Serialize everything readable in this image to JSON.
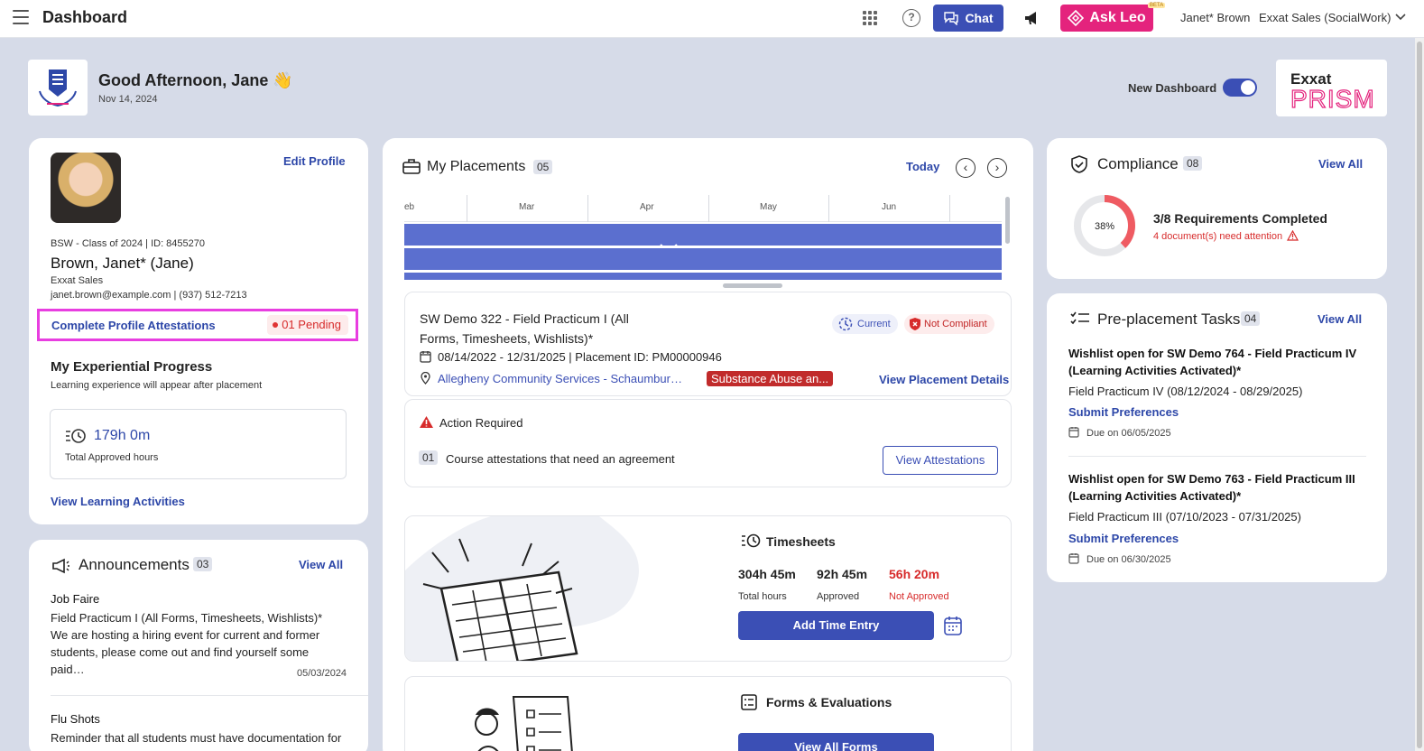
{
  "header": {
    "title": "Dashboard",
    "chat_label": "Chat",
    "askleo_label": "Ask Leo",
    "beta_label": "BETA",
    "user_name": "Janet* Brown",
    "user_org": "Exxat Sales (SocialWork)"
  },
  "greeting": {
    "title": "Good Afternoon, Jane 👋",
    "date": "Nov 14, 2024",
    "new_dashboard_label": "New Dashboard",
    "prism_line1": "Exxat",
    "prism_line2": "PRISM"
  },
  "profile": {
    "edit_label": "Edit Profile",
    "class_line": "BSW - Class of 2024  | ID: 8455270",
    "name": "Brown, Janet* (Jane)",
    "org": "Exxat Sales",
    "contact": "janet.brown@example.com  | (937) 512-7213",
    "attestations_link": "Complete Profile Attestations",
    "pending_label": "01 Pending",
    "progress_title": "My Experiential Progress",
    "progress_sub": "Learning experience will appear after placement",
    "hours_value": "179h 0m",
    "hours_label": "Total Approved hours",
    "view_learning": "View Learning Activities"
  },
  "announcements": {
    "title": "Announcements",
    "count": "03",
    "view_all": "View All",
    "items": [
      {
        "title": "Job Faire",
        "course": "Field Practicum I (All Forms, Timesheets, Wishlists)*",
        "body": "We are hosting a hiring event for current and former students, please come out and find yourself some paid…",
        "date": "05/03/2024"
      },
      {
        "title": "Flu Shots",
        "body": "Reminder that all students must have documentation for"
      }
    ]
  },
  "placements": {
    "title": "My Placements",
    "count": "05",
    "today_label": "Today",
    "timeline_months": [
      "eb",
      "Mar",
      "Apr",
      "May",
      "Jun"
    ],
    "course": "SW Demo 322 - Field Practicum I (All Forms, Timesheets, Wishlists)*",
    "status_current": "Current",
    "status_compliance": "Not Compliant",
    "dates": "08/14/2022 - 12/31/2025 | Placement ID: PM00000946",
    "site": "Allegheny Community Services - Schaumburg…",
    "tag": "Substance Abuse an...",
    "view_details": "View Placement Details",
    "action_title": "Action Required",
    "action_num": "01",
    "action_text": "Course attestations that need an agreement",
    "action_button": "View Attestations"
  },
  "timesheets": {
    "title": "Timesheets",
    "total_value": "304h 45m",
    "total_label": "Total hours",
    "approved_value": "92h 45m",
    "approved_label": "Approved",
    "not_approved_value": "56h 20m",
    "not_approved_label": "Not Approved",
    "add_button": "Add Time Entry"
  },
  "forms": {
    "title": "Forms & Evaluations",
    "button": "View All Forms"
  },
  "compliance": {
    "title": "Compliance",
    "count": "08",
    "view_all": "View All",
    "percent_label": "38%",
    "percent_value": 38,
    "requirements": "3/8 Requirements Completed",
    "attention": "4 document(s) need attention"
  },
  "preplacement": {
    "title": "Pre-placement Tasks",
    "count": "04",
    "view_all": "View All",
    "items": [
      {
        "title": "Wishlist open for SW Demo 764 - Field Practicum IV (Learning Activities Activated)*",
        "course": "Field Practicum IV (08/12/2024 - 08/29/2025)",
        "action": "Submit Preferences",
        "due": "Due on 06/05/2025"
      },
      {
        "title": "Wishlist open for SW Demo 763 - Field Practicum III (Learning Activities Activated)*",
        "course": "Field Practicum III (07/10/2023 - 07/31/2025)",
        "action": "Submit Preferences",
        "due": "Due on 06/30/2025"
      }
    ]
  },
  "colors": {
    "primary": "#3b4fb5",
    "accent_pink": "#e4237d",
    "alert_red": "#d72b2b",
    "background": "#d6dbe8"
  }
}
